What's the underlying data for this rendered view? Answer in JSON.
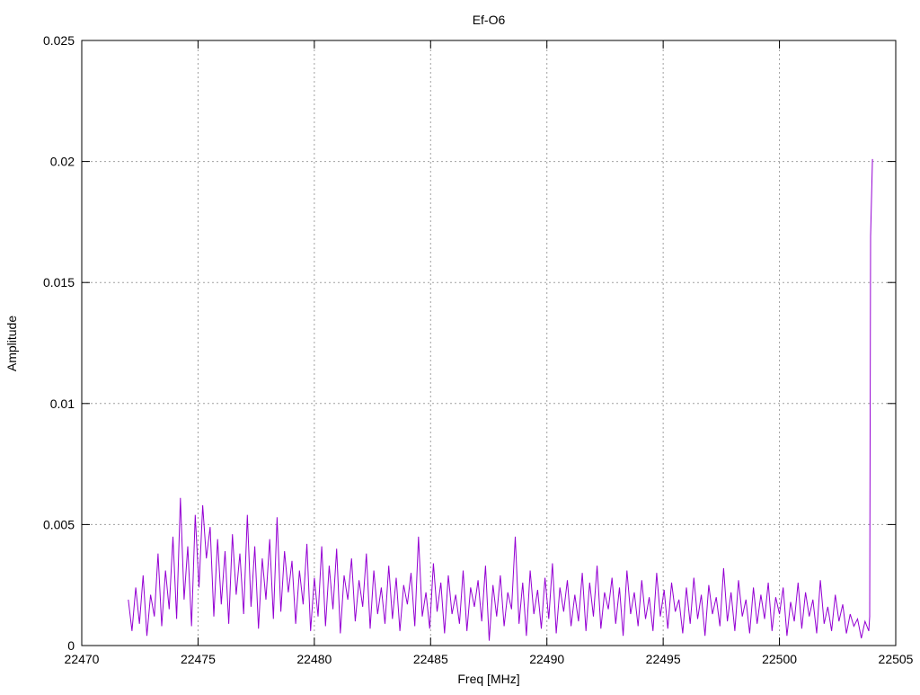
{
  "chart_data": {
    "type": "line",
    "title": "Ef-O6",
    "xlabel": "Freq [MHz]",
    "ylabel": "Amplitude",
    "xlim": [
      22470,
      22505
    ],
    "ylim": [
      0,
      0.025
    ],
    "xticks": [
      22470,
      22475,
      22480,
      22485,
      22490,
      22495,
      22500,
      22505
    ],
    "yticks": [
      0,
      0.005,
      0.01,
      0.015,
      0.02,
      0.025
    ],
    "ytick_labels": [
      "0",
      "0.005",
      "0.01",
      "0.015",
      "0.02",
      "0.025"
    ],
    "grid": true,
    "legend": "none",
    "series": [
      {
        "name": "Ef-O6",
        "color": "#9400d3",
        "x_start": 22472.0,
        "x_step": 0.16,
        "y": [
          0.0019,
          0.0006,
          0.0024,
          0.0009,
          0.0029,
          0.0004,
          0.0021,
          0.0012,
          0.0038,
          0.0008,
          0.0031,
          0.0015,
          0.0045,
          0.0011,
          0.0061,
          0.0019,
          0.0041,
          0.0008,
          0.0054,
          0.0024,
          0.0058,
          0.0036,
          0.0049,
          0.0012,
          0.0044,
          0.0017,
          0.0039,
          0.0009,
          0.0046,
          0.0021,
          0.0038,
          0.0013,
          0.0054,
          0.0016,
          0.0041,
          0.0007,
          0.0036,
          0.0019,
          0.0044,
          0.0011,
          0.0053,
          0.0014,
          0.0039,
          0.0022,
          0.0035,
          0.0009,
          0.0031,
          0.0017,
          0.0042,
          0.0006,
          0.0028,
          0.0012,
          0.0041,
          0.0008,
          0.0033,
          0.0015,
          0.004,
          0.0005,
          0.0029,
          0.0019,
          0.0036,
          0.001,
          0.0027,
          0.0016,
          0.0038,
          0.0007,
          0.0031,
          0.0013,
          0.0024,
          0.0009,
          0.0033,
          0.0011,
          0.0028,
          0.0006,
          0.0025,
          0.0017,
          0.003,
          0.0008,
          0.0045,
          0.0012,
          0.0022,
          0.0007,
          0.0034,
          0.0014,
          0.0026,
          0.0005,
          0.0029,
          0.0013,
          0.0021,
          0.0009,
          0.0031,
          0.0006,
          0.0024,
          0.0016,
          0.0027,
          0.001,
          0.0033,
          0.0002,
          0.0025,
          0.0012,
          0.0029,
          0.0008,
          0.0022,
          0.0015,
          0.0045,
          0.0009,
          0.0026,
          0.0004,
          0.0031,
          0.0013,
          0.0023,
          0.0007,
          0.0028,
          0.0011,
          0.0034,
          0.0005,
          0.0024,
          0.0014,
          0.0027,
          0.0008,
          0.0021,
          0.001,
          0.003,
          0.0006,
          0.0026,
          0.0012,
          0.0033,
          0.0007,
          0.0022,
          0.0015,
          0.0028,
          0.0009,
          0.0024,
          0.0004,
          0.0031,
          0.0013,
          0.0022,
          0.0008,
          0.0027,
          0.0011,
          0.002,
          0.0006,
          0.003,
          0.0012,
          0.0023,
          0.0007,
          0.0026,
          0.0014,
          0.0019,
          0.0005,
          0.0024,
          0.0009,
          0.0028,
          0.0011,
          0.0021,
          0.0004,
          0.0025,
          0.0013,
          0.002,
          0.0008,
          0.0032,
          0.001,
          0.0022,
          0.0006,
          0.0027,
          0.0012,
          0.0019,
          0.0005,
          0.0024,
          0.0009,
          0.0021,
          0.0011,
          0.0026,
          0.0006,
          0.002,
          0.0013,
          0.0024,
          0.0004,
          0.0018,
          0.001,
          0.0026,
          0.0007,
          0.0022,
          0.0012,
          0.0019,
          0.0005,
          0.0027,
          0.0009,
          0.0016,
          0.0006,
          0.0021,
          0.001,
          0.0017,
          0.0005,
          0.0013,
          0.0008,
          0.0011,
          0.0003,
          0.001,
          0.0006
        ],
        "tail_points": [
          [
            22503.88,
            0.0012
          ],
          [
            22503.92,
            0.0169
          ],
          [
            22504.0,
            0.0201
          ]
        ]
      }
    ]
  }
}
